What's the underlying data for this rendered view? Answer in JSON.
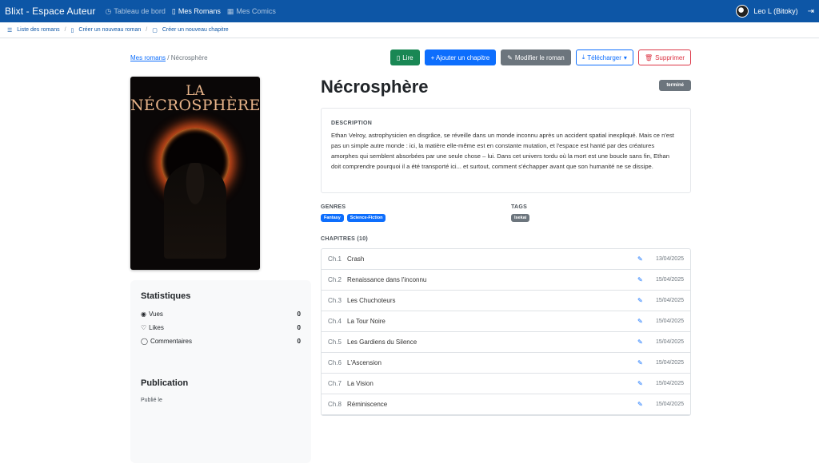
{
  "navbar": {
    "brand": "Blixt - Espace Auteur",
    "links": [
      {
        "label": "Tableau de bord",
        "icon": "dashboard-icon"
      },
      {
        "label": "Mes Romans",
        "icon": "book-icon"
      },
      {
        "label": "Mes Comics",
        "icon": "grid-icon"
      }
    ],
    "user": "Leo L (Bitoky)",
    "logout_icon": "logout-icon"
  },
  "subnav": {
    "items": [
      "Liste des romans",
      "Créer un nouveau roman",
      "Créer un nouveau chapitre"
    ]
  },
  "breadcrumb": {
    "parent": "Mes romans",
    "sep": "/",
    "current": "Nécrosphère"
  },
  "toolbar": {
    "read": "Lire",
    "add_chapter": "+ Ajouter un chapitre",
    "edit": "Modifier le roman",
    "download": "Télécharger",
    "delete": "Supprimer"
  },
  "cover": {
    "line1": "LA",
    "line2": "NÉCROSPHÈRE"
  },
  "stats": {
    "title": "Statistiques",
    "rows": [
      {
        "label": "Vues",
        "value": "0",
        "icon": "eye-icon"
      },
      {
        "label": "Likes",
        "value": "0",
        "icon": "heart-icon"
      },
      {
        "label": "Commentaires",
        "value": "0",
        "icon": "comment-icon"
      }
    ]
  },
  "publication": {
    "title": "Publication",
    "published_label": "Publié le"
  },
  "novel": {
    "title": "Nécrosphère",
    "status": "terminé",
    "description_label": "DESCRIPTION",
    "description": "Ethan Velroy, astrophysicien en disgrâce, se réveille dans un monde inconnu après un accident spatial inexpliqué. Mais ce n'est pas un simple autre monde : ici, la matière elle-même est en constante mutation, et l'espace est hanté par des créatures amorphes qui semblent absorbées par une seule chose – lui. Dans cet univers tordu où la mort est une boucle sans fin, Ethan doit comprendre pourquoi il a été transporté ici... et surtout, comment s'échapper avant que son humanité ne se dissipe.",
    "genres_label": "GENRES",
    "genres": [
      "Fantasy",
      "Science-Fiction"
    ],
    "tags_label": "TAGS",
    "tags": [
      "Isekai"
    ],
    "chapters_label": "CHAPITRES (10)"
  },
  "chapters": [
    {
      "num": "Ch.1",
      "title": "Crash",
      "date": "13/04/2025"
    },
    {
      "num": "Ch.2",
      "title": "Renaissance dans l'inconnu",
      "date": "15/04/2025"
    },
    {
      "num": "Ch.3",
      "title": "Les Chuchoteurs",
      "date": "15/04/2025"
    },
    {
      "num": "Ch.4",
      "title": "La Tour Noire",
      "date": "15/04/2025"
    },
    {
      "num": "Ch.5",
      "title": "Les Gardiens du Silence",
      "date": "15/04/2025"
    },
    {
      "num": "Ch.6",
      "title": "L'Ascension",
      "date": "15/04/2025"
    },
    {
      "num": "Ch.7",
      "title": "La Vision",
      "date": "15/04/2025"
    },
    {
      "num": "Ch.8",
      "title": "Réminiscence",
      "date": "15/04/2025"
    }
  ]
}
